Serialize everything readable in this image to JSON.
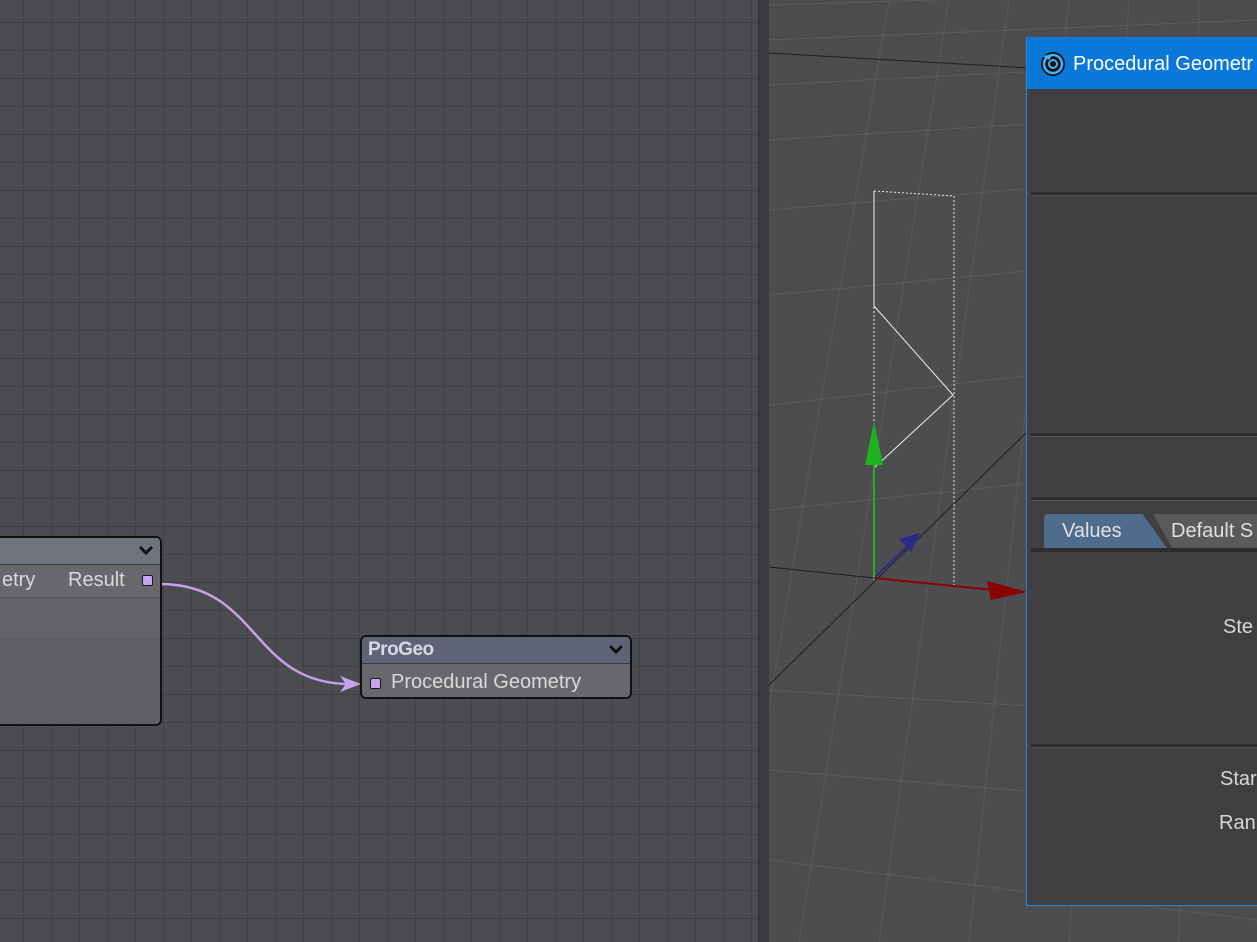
{
  "node_editor": {
    "left_node": {
      "input_label": "etry",
      "output_label": "Result"
    },
    "progeo_node": {
      "title": "ProGeo",
      "input_label": "Procedural Geometry"
    },
    "connection_color": "#c8a0ee"
  },
  "viewport": {
    "axis_colors": {
      "x": "#8b0000",
      "y": "#1db31d",
      "z": "#2a2a8a"
    }
  },
  "properties_panel": {
    "title": "Procedural Geometr",
    "accent": "#0a78d8",
    "tabs": [
      {
        "label": "Values"
      },
      {
        "label": "Default S"
      }
    ],
    "labels": {
      "step": "Ste",
      "start": "Star",
      "range": "Ran"
    }
  }
}
